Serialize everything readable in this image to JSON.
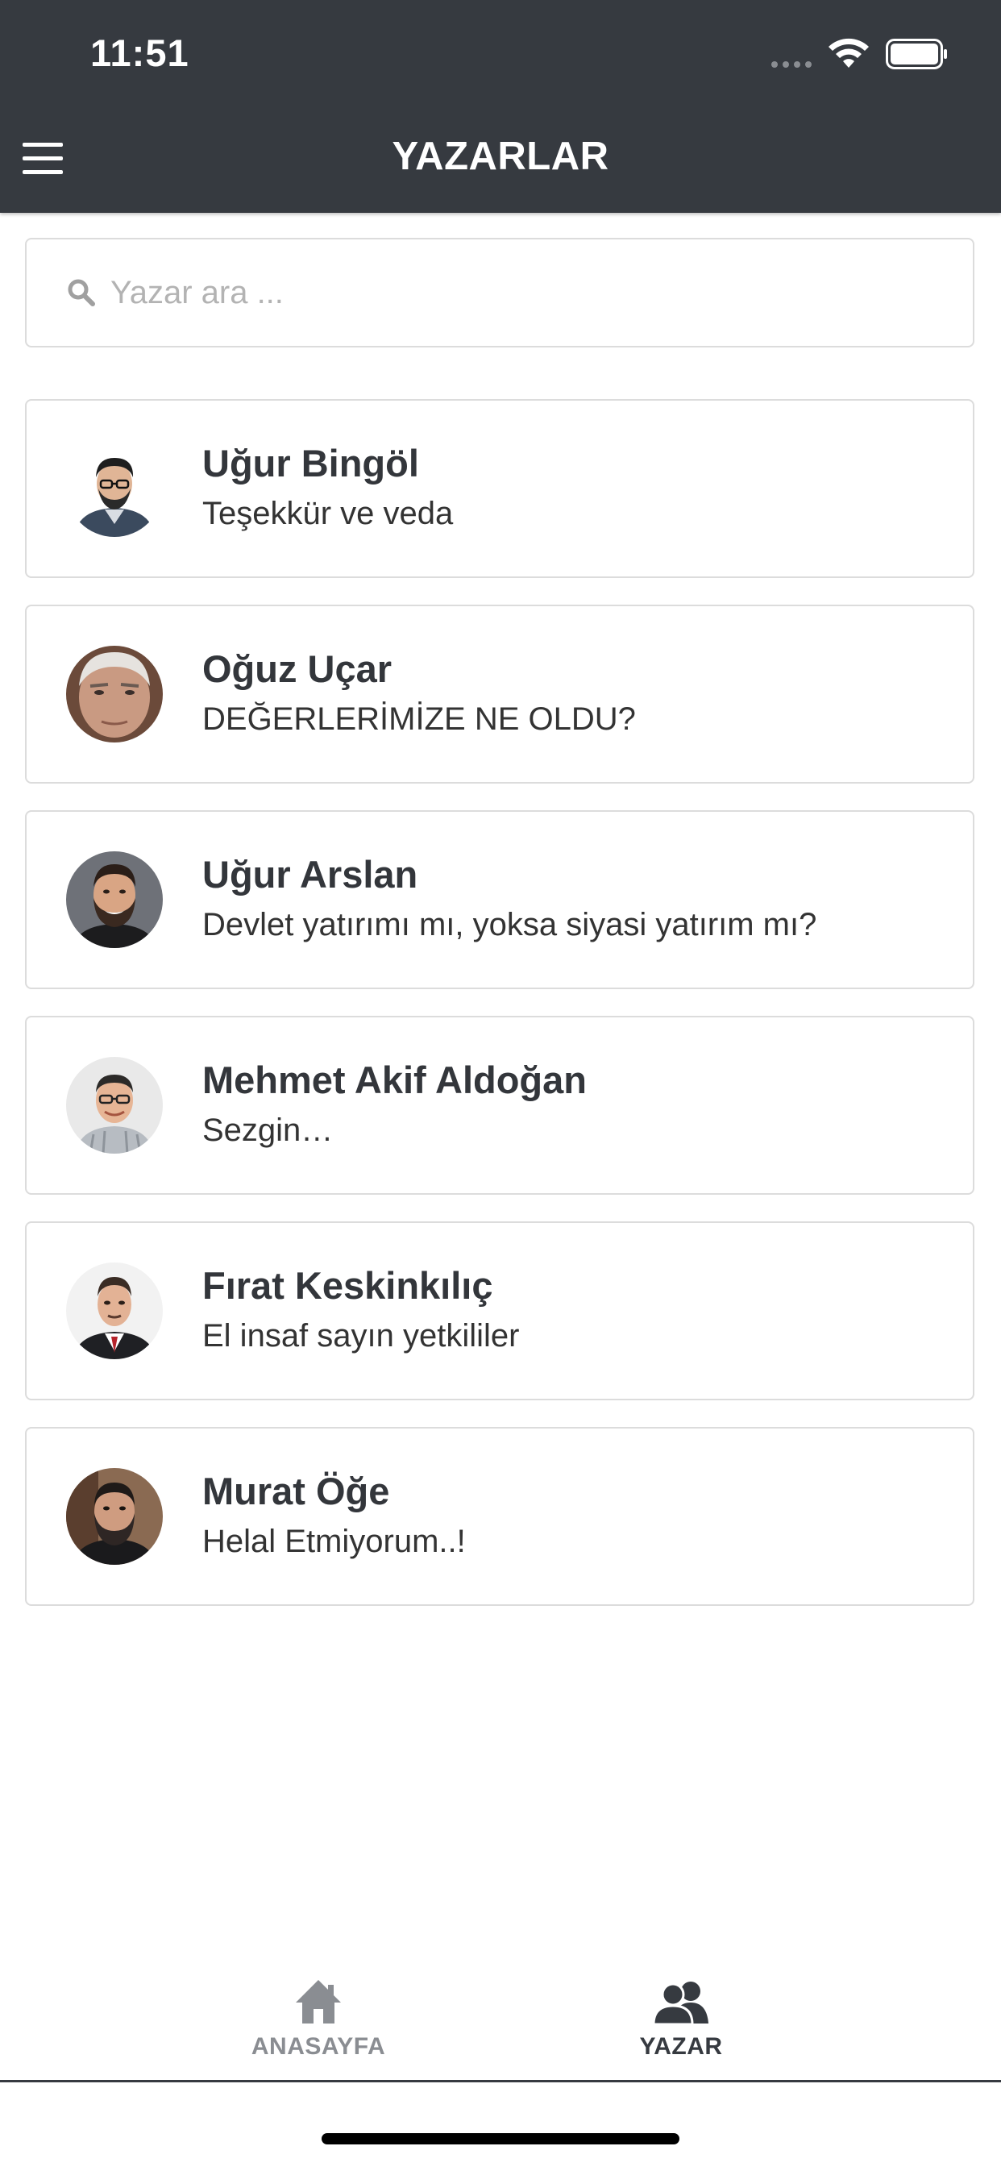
{
  "status_bar": {
    "time": "11:51"
  },
  "header": {
    "title": "YAZARLAR",
    "background_color": "#363a40"
  },
  "search": {
    "placeholder": "Yazar ara ...",
    "value": ""
  },
  "authors": [
    {
      "name": "Uğur Bingöl",
      "article": "Teşekkür ve veda",
      "avatar_icon": "person-portrait"
    },
    {
      "name": "Oğuz Uçar",
      "article": "DEĞERLERİMİZE NE OLDU?",
      "avatar_icon": "person-portrait"
    },
    {
      "name": "Uğur Arslan",
      "article": "Devlet yatırımı mı, yoksa siyasi yatırım mı?",
      "avatar_icon": "person-portrait"
    },
    {
      "name": "Mehmet Akif Aldoğan",
      "article": "Sezgin…",
      "avatar_icon": "person-portrait"
    },
    {
      "name": "Fırat Keskinkılıç",
      "article": "El insaf sayın yetkililer",
      "avatar_icon": "person-portrait"
    },
    {
      "name": "Murat Öğe",
      "article": "Helal Etmiyorum..!",
      "avatar_icon": "person-portrait"
    }
  ],
  "tabbar": {
    "home_label": "ANASAYFA",
    "author_label": "YAZAR",
    "active_tab": "YAZAR",
    "inactive_color": "#8a8d92",
    "active_color": "#363a40"
  }
}
